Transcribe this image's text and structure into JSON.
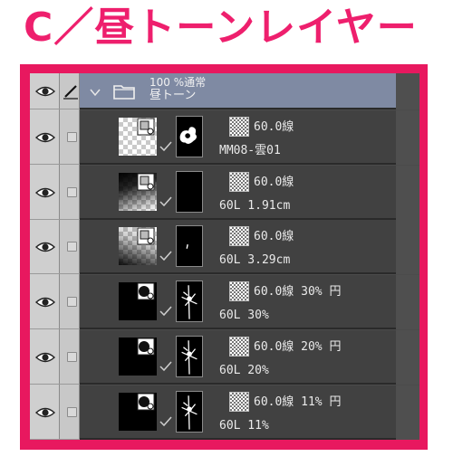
{
  "heading": "C／昼トーンレイヤー",
  "folder": {
    "mode": "100 %通常",
    "name": "昼トーン"
  },
  "layers": [
    {
      "tone": "60.0線",
      "name": "MM08-雲01",
      "thumb_style": "checker-gray",
      "mask": "cloud"
    },
    {
      "tone": "60.0線",
      "name": "60L 1.91cm",
      "thumb_style": "gradient-checker",
      "mask": "empty"
    },
    {
      "tone": "60.0線",
      "name": "60L 3.29cm",
      "thumb_style": "gradient-light",
      "mask": "speck"
    },
    {
      "tone": "60.0線 30% 円",
      "name": "60L 30%",
      "thumb_style": "black",
      "mask": "stroke"
    },
    {
      "tone": "60.0線 20% 円",
      "name": "60L 20%",
      "thumb_style": "black",
      "mask": "stroke"
    },
    {
      "tone": "60.0線 11% 円",
      "name": "60L 11%",
      "thumb_style": "black",
      "mask": "stroke"
    }
  ],
  "colors": {
    "heading": "#ee1f6d",
    "frame": "#e8185f",
    "folder_row": "#7f8aa3",
    "panel": "#4b4b4b"
  },
  "icons": [
    "eye-icon",
    "pencil-icon",
    "chevron-down-icon",
    "folder-icon",
    "checkbox",
    "tone-pattern-icon",
    "check-icon"
  ]
}
